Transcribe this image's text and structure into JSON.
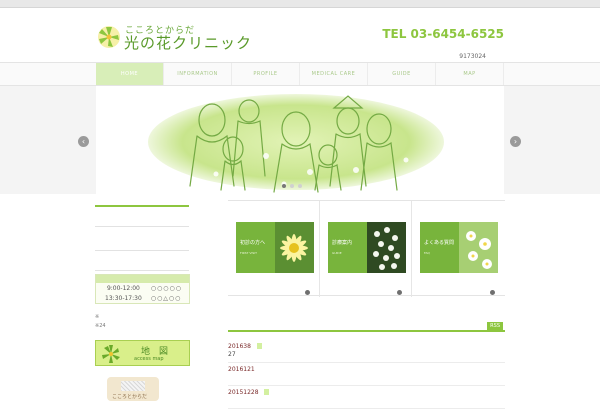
{
  "header": {
    "logo_sub": "こころとからだ",
    "logo_main": "光の花クリニック",
    "tel": "TEL 03-6454-6525",
    "tel_sub": "9173024"
  },
  "nav": {
    "items": [
      {
        "label": "HOME"
      },
      {
        "label": "INFORMATION"
      },
      {
        "label": "PROFILE"
      },
      {
        "label": "MEDICAL CARE"
      },
      {
        "label": "GUIDE"
      },
      {
        "label": "MAP"
      }
    ],
    "active_index": 0
  },
  "slider": {
    "left_arrow": "‹",
    "right_arrow": "›",
    "active_dot": 0
  },
  "sidebar": {
    "hours": [
      {
        "time": "9:00-12:00",
        "marks": "○○○○○"
      },
      {
        "time": "13:30-17:30",
        "marks": "○○△○○"
      }
    ],
    "note1": "※",
    "note2": "※24",
    "map_label": "地　図",
    "map_sub": "access map",
    "card_label": "こころとからだ"
  },
  "features": [
    {
      "label": "初診の方へ",
      "sub": "FIRST VISIT"
    },
    {
      "label": "診療案内",
      "sub": "GUIDE"
    },
    {
      "label": "よくある質問",
      "sub": "FAQ"
    }
  ],
  "news": {
    "rss": "RSS",
    "items": [
      {
        "date": "201638",
        "text": "27"
      },
      {
        "date": "2016121",
        "text": ""
      },
      {
        "date": "20151228",
        "text": ""
      }
    ]
  },
  "colors": {
    "accent": "#8dc63f",
    "nav_active": "#d8eeb8",
    "date_red": "#7a2a2a"
  }
}
